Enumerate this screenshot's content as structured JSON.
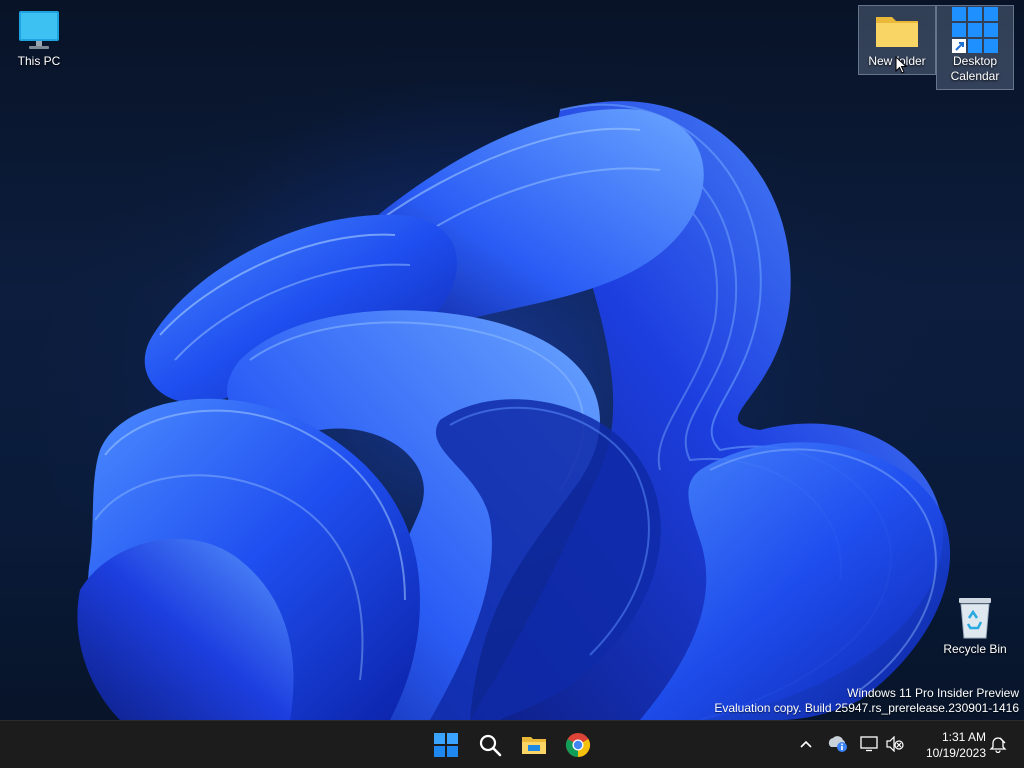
{
  "desktop": {
    "icons": [
      {
        "label": "This PC",
        "icon": "monitor-icon"
      },
      {
        "label": "New folder",
        "icon": "folder-icon"
      },
      {
        "label": "Desktop Calendar",
        "icon": "calendar-grid-icon"
      },
      {
        "label": "Recycle Bin",
        "icon": "recycle-bin-icon"
      }
    ],
    "watermark": {
      "line1": "Windows 11 Pro Insider Preview",
      "line2": "Evaluation copy. Build 25947.rs_prerelease.230901-1416"
    }
  },
  "taskbar": {
    "apps": [
      {
        "name": "Start",
        "icon": "windows-start-icon"
      },
      {
        "name": "Search",
        "icon": "search-icon"
      },
      {
        "name": "File Explorer",
        "icon": "file-explorer-icon"
      },
      {
        "name": "Google Chrome",
        "icon": "chrome-icon"
      }
    ],
    "tray": {
      "icons": [
        "chevron-up-icon",
        "network-info-icon",
        "display-icon",
        "volume-muted-icon",
        "notification-icon"
      ],
      "time": "1:31 AM",
      "date": "10/19/2023"
    }
  },
  "colors": {
    "accent": "#0a72d6",
    "taskbar": "#1c1c1c",
    "wallpaper_dark": "#0c1d3d",
    "bloom_blue": "#1f4ff0"
  }
}
